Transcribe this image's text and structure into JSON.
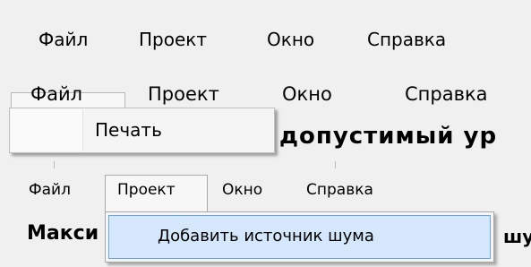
{
  "menus": [
    {
      "file": "Файл",
      "project": "Проект",
      "window": "Окно",
      "help": "Справка"
    },
    {
      "file": "Файл",
      "project": "Проект",
      "window": "Окно",
      "help": "Справка"
    },
    {
      "file": "Файл",
      "project": "Проект",
      "window": "Окно",
      "help": "Справка"
    }
  ],
  "dropdown_file": {
    "item": "Печать"
  },
  "dropdown_project": {
    "item": "Добавить источник шума"
  },
  "background": {
    "heading_fragment": "допустимый ур",
    "label_fragment_1": "Макси",
    "label_fragment_2": "шу"
  },
  "colors": {
    "menu_bg": "#f0f0f0",
    "highlight": "#d5e8fb",
    "highlight_border": "#6aa3dd"
  }
}
